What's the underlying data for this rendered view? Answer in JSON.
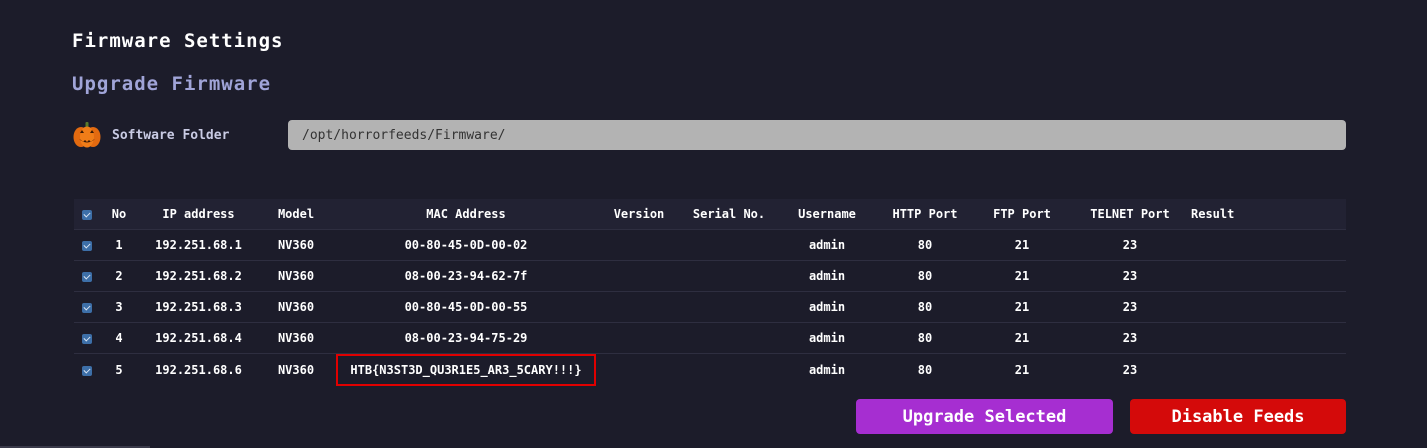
{
  "header": {
    "title": "Firmware Settings",
    "subtitle": "Upgrade Firmware"
  },
  "folder": {
    "icon": "pumpkin-icon",
    "label": "Software Folder",
    "value": "/opt/horrorfeeds/Firmware/"
  },
  "table": {
    "columns": [
      "No",
      "IP address",
      "Model",
      "MAC Address",
      "Version",
      "Serial No.",
      "Username",
      "HTTP Port",
      "FTP Port",
      "TELNET Port",
      "Result"
    ],
    "rows": [
      {
        "no": "1",
        "ip": "192.251.68.1",
        "model": "NV360",
        "mac": "00-80-45-0D-00-02",
        "version": "",
        "serial": "",
        "username": "admin",
        "http": "80",
        "ftp": "21",
        "telnet": "23",
        "result": "",
        "checked": true
      },
      {
        "no": "2",
        "ip": "192.251.68.2",
        "model": "NV360",
        "mac": "08-00-23-94-62-7f",
        "version": "",
        "serial": "",
        "username": "admin",
        "http": "80",
        "ftp": "21",
        "telnet": "23",
        "result": "",
        "checked": true
      },
      {
        "no": "3",
        "ip": "192.251.68.3",
        "model": "NV360",
        "mac": "00-80-45-0D-00-55",
        "version": "",
        "serial": "",
        "username": "admin",
        "http": "80",
        "ftp": "21",
        "telnet": "23",
        "result": "",
        "checked": true
      },
      {
        "no": "4",
        "ip": "192.251.68.4",
        "model": "NV360",
        "mac": "08-00-23-94-75-29",
        "version": "",
        "serial": "",
        "username": "admin",
        "http": "80",
        "ftp": "21",
        "telnet": "23",
        "result": "",
        "checked": true
      },
      {
        "no": "5",
        "ip": "192.251.68.6",
        "model": "NV360",
        "mac": "HTB{N3ST3D_QU3R1E5_AR3_5CARY!!!}",
        "version": "",
        "serial": "",
        "username": "admin",
        "http": "80",
        "ftp": "21",
        "telnet": "23",
        "result": "",
        "checked": true,
        "highlighted": true
      }
    ]
  },
  "actions": {
    "upgrade_label": "Upgrade Selected",
    "disable_label": "Disable Feeds"
  },
  "colors": {
    "background": "#1c1c2a",
    "subtitle": "#a0a4d8",
    "upgrade_button": "#a62ed1",
    "disable_button": "#d40a0a",
    "highlight_border": "#e00000"
  }
}
